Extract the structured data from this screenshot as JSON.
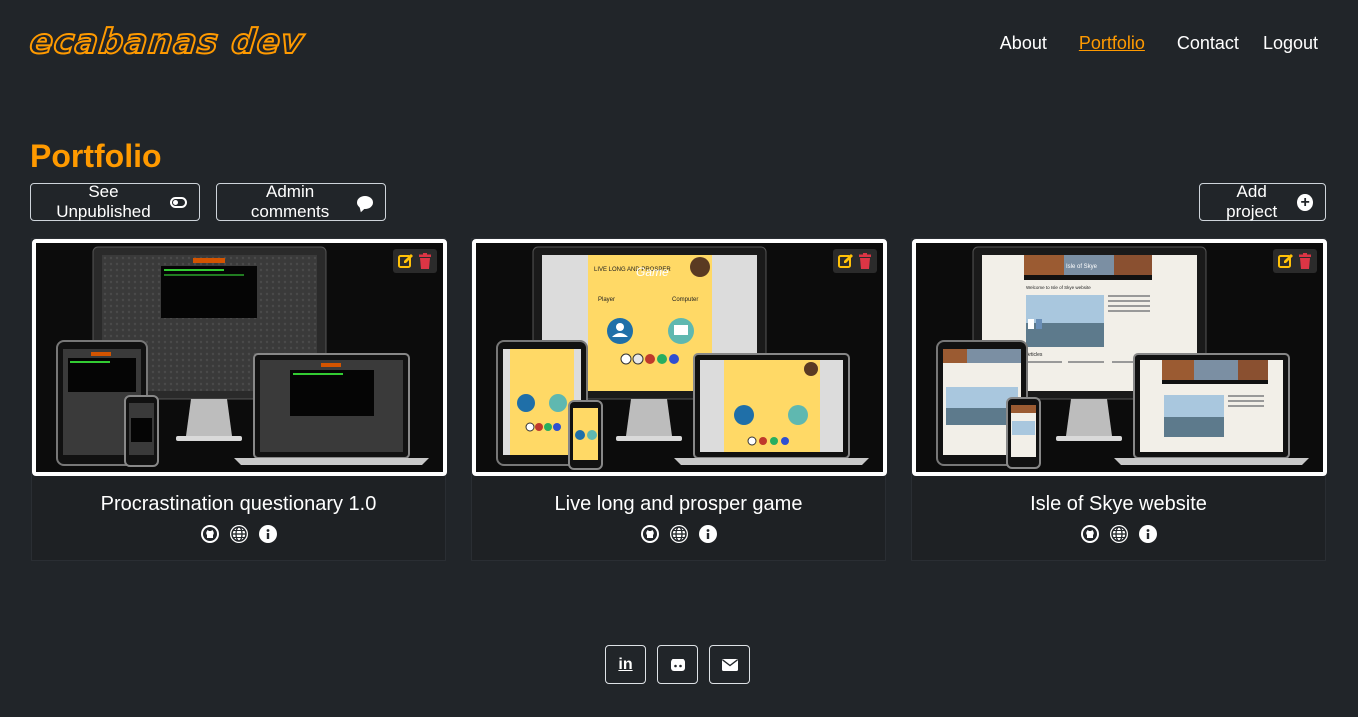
{
  "header": {
    "logo": "ecabanas dev",
    "nav": [
      {
        "label": "About",
        "active": false
      },
      {
        "label": "Portfolio",
        "active": true
      },
      {
        "label": "Contact",
        "active": false
      },
      {
        "label": "Logout",
        "active": false
      }
    ]
  },
  "page": {
    "title": "Portfolio",
    "see_unpublished_label": "See Unpublished",
    "admin_comments_label": "Admin comments",
    "add_project_label": "Add project"
  },
  "projects": [
    {
      "title": "Procrastination questionary 1.0",
      "links": [
        "github-icon",
        "globe-icon",
        "info-icon"
      ],
      "actions": [
        "edit-icon",
        "delete-icon"
      ]
    },
    {
      "title": "Live long and prosper game",
      "links": [
        "github-icon",
        "globe-icon",
        "info-icon"
      ],
      "actions": [
        "edit-icon",
        "delete-icon"
      ]
    },
    {
      "title": "Isle of Skye website",
      "links": [
        "github-icon",
        "globe-icon",
        "info-icon"
      ],
      "actions": [
        "edit-icon",
        "delete-icon"
      ]
    }
  ],
  "mockup_text": {
    "game_title_small": "LIVE LONG AND PROSPER",
    "game_title_big": "Game",
    "player": "Player",
    "computer": "Computer",
    "skye_banner": "Isle of Skye",
    "skye_welcome": "Welcome to Isle of Skye website",
    "skye_articles": "Articles"
  },
  "footer": {
    "links": [
      "linkedin-icon",
      "github-icon",
      "email-icon"
    ],
    "linkedin_text": "in"
  },
  "colors": {
    "background": "#212529",
    "accent": "#ff9a00",
    "edit": "#ffc107",
    "delete": "#dc3545",
    "text": "#ffffff"
  }
}
